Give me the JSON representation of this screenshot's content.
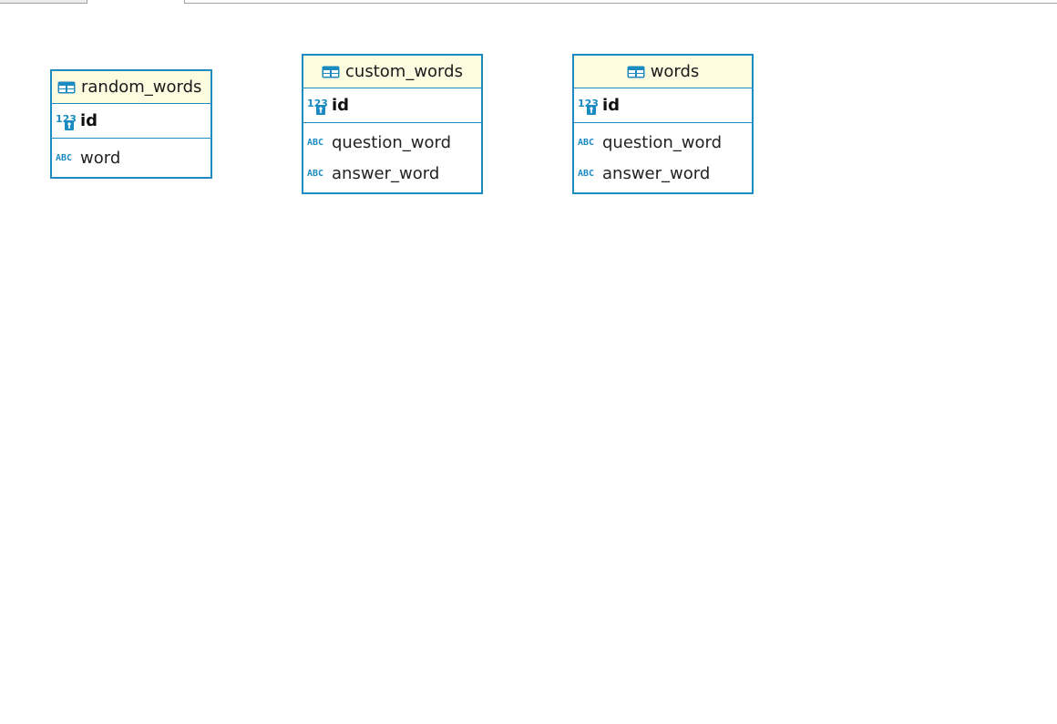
{
  "colors": {
    "border": "#1b8bc2",
    "header_bg": "#fdfbe0",
    "icon": "#1b8bc2"
  },
  "icons": {
    "table": "table-icon",
    "numeric": "numeric-column-icon",
    "text": "text-column-icon",
    "key": "key-icon"
  },
  "entities": [
    {
      "name": "random_words",
      "primary_key": {
        "name": "id",
        "type_icon": "numeric-key"
      },
      "columns": [
        {
          "name": "word",
          "type_icon": "text"
        }
      ]
    },
    {
      "name": "custom_words",
      "primary_key": {
        "name": "id",
        "type_icon": "numeric-key"
      },
      "columns": [
        {
          "name": "question_word",
          "type_icon": "text"
        },
        {
          "name": "answer_word",
          "type_icon": "text"
        }
      ]
    },
    {
      "name": "words",
      "primary_key": {
        "name": "id",
        "type_icon": "numeric-key"
      },
      "columns": [
        {
          "name": "question_word",
          "type_icon": "text"
        },
        {
          "name": "answer_word",
          "type_icon": "text"
        }
      ]
    }
  ]
}
